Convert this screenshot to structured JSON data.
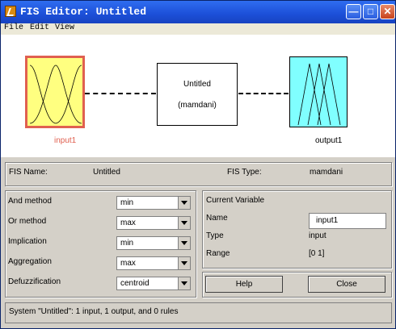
{
  "window": {
    "title": "FIS Editor: Untitled"
  },
  "menu": [
    "File",
    "Edit",
    "View"
  ],
  "diagram": {
    "input_label": "input1",
    "output_label": "output1",
    "system_name": "Untitled",
    "system_type": "(mamdani)"
  },
  "info": {
    "fis_name_label": "FIS Name:",
    "fis_name_value": "Untitled",
    "fis_type_label": "FIS Type:",
    "fis_type_value": "mamdani"
  },
  "methods": [
    {
      "label": "And method",
      "value": "min"
    },
    {
      "label": "Or method",
      "value": "max"
    },
    {
      "label": "Implication",
      "value": "min"
    },
    {
      "label": "Aggregation",
      "value": "max"
    },
    {
      "label": "Defuzzification",
      "value": "centroid"
    }
  ],
  "current_variable": {
    "header": "Current Variable",
    "name_label": "Name",
    "name_value": "input1",
    "type_label": "Type",
    "type_value": "input",
    "range_label": "Range",
    "range_value": "[0 1]"
  },
  "buttons": {
    "help": "Help",
    "close": "Close"
  },
  "status": "System \"Untitled\": 1 input, 1 output, and 0 rules",
  "colors": {
    "input_fill": "#ffff80",
    "input_highlight": "#e06050",
    "output_fill": "#80ffff",
    "titlebar": "#1c4fd8"
  }
}
